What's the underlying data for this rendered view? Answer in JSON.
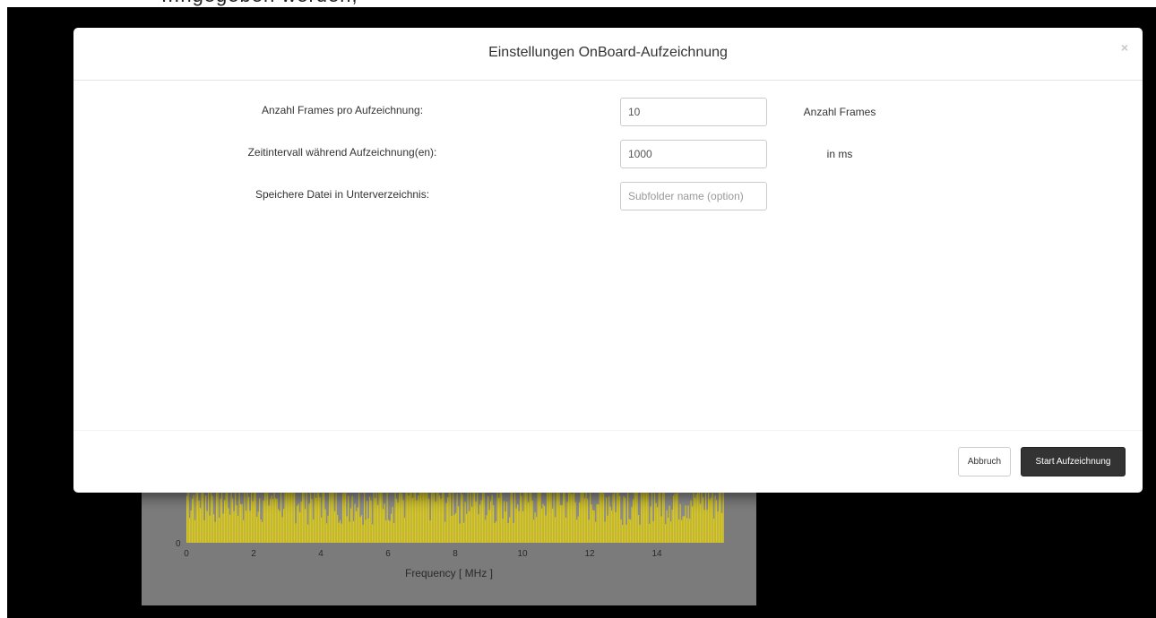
{
  "modal": {
    "title": "Einstellungen OnBoard-Aufzeichnung",
    "close_glyph": "×",
    "fields": [
      {
        "label": "Anzahl Frames pro Aufzeichnung:",
        "value": "10",
        "placeholder": "",
        "unit": "Anzahl Frames"
      },
      {
        "label": "Zeitintervall während Aufzeichnung(en):",
        "value": "1000",
        "placeholder": "",
        "unit": "in ms"
      },
      {
        "label": "Speichere Datei in Unterverzeichnis:",
        "value": "",
        "placeholder": "Subfolder name (option)",
        "unit": ""
      }
    ],
    "cancel_label": "Abbruch",
    "start_label": "Start Aufzeichnung"
  },
  "background": {
    "top_text": "...ngegeben werden,",
    "chart": {
      "xlabel": "Frequency [ MHz ]",
      "x_ticks": [
        "0",
        "2",
        "4",
        "6",
        "8",
        "10",
        "12",
        "14"
      ],
      "y_ticks": [
        "0"
      ],
      "color": "#d9c91a"
    }
  },
  "chart_data": {
    "type": "bar",
    "title": "",
    "xlabel": "Frequency [ MHz ]",
    "ylabel": "",
    "x_ticks": [
      0,
      2,
      4,
      6,
      8,
      10,
      12,
      14
    ],
    "y_ticks": [
      0
    ]
  }
}
